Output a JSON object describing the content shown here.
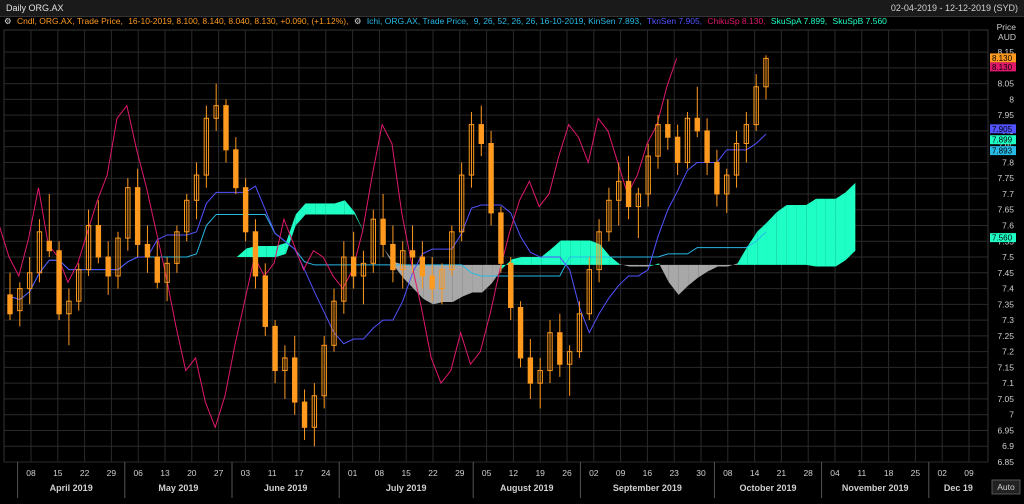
{
  "header": {
    "title": "Daily ORG.AX",
    "date_range": "02-04-2019 - 12-12-2019 (SYD)"
  },
  "legend": {
    "cndl": {
      "label": "Cndl, ORG.AX, Trade Price,",
      "vals": "16-10-2019, 8.100, 8.140, 8.040, 8.130, +0.090, (+1.12%),"
    },
    "ichi": {
      "label": "Ichi, ORG.AX, Trade Price,",
      "vals": "9, 26, 52, 26, 26, 16-10-2019, KinSen 7.893,"
    },
    "tenkan": "TknSen 7.905,",
    "chikou": "ChikuSp 8.130,",
    "spanA": "SkuSpA 7.899,",
    "spanB": "SkuSpB 7.560"
  },
  "axis": {
    "price_label": "Price",
    "currency_label": "AUD",
    "auto_label": "Auto"
  },
  "colors": {
    "bg": "#000000",
    "grid": "#2a2a2a",
    "candle": "#ff9a1e",
    "tenkan": "#5252ff",
    "kijun": "#27b9e6",
    "chikou": "#e0186c",
    "cloud_bull": "#1effc6",
    "cloud_bear": "#a8a8a8",
    "text": "#cfcfcf"
  },
  "chart_data": {
    "type": "candlestick",
    "ylim": [
      6.85,
      8.22
    ],
    "yticks": [
      6.85,
      6.9,
      6.95,
      7,
      7.05,
      7.1,
      7.15,
      7.2,
      7.25,
      7.3,
      7.35,
      7.4,
      7.45,
      7.5,
      7.55,
      7.6,
      7.65,
      7.7,
      7.75,
      7.8,
      7.85,
      7.9,
      7.95,
      8,
      8.05,
      8.1,
      8.15
    ],
    "ytick_labels": [
      "6.85",
      "6.9",
      "6.95",
      "7",
      "7.05",
      "7.1",
      "7.15",
      "7.2",
      "7.25",
      "7.3",
      "7.35",
      "7.4",
      "7.45",
      "7.5",
      "7.55",
      "7.6",
      "7.65",
      "7.7",
      "7.75",
      "7.8",
      "7.85",
      "7.9",
      "7.95",
      "8",
      "8.05",
      "8.1",
      "8.15"
    ],
    "x_dates": [
      "08",
      "15",
      "22",
      "29",
      "06",
      "13",
      "20",
      "27",
      "03",
      "11",
      "17",
      "24",
      "01",
      "08",
      "15",
      "22",
      "29",
      "05",
      "12",
      "19",
      "26",
      "02",
      "09",
      "16",
      "23",
      "30",
      "08",
      "14",
      "21",
      "28",
      "04",
      "11",
      "18",
      "25",
      "02",
      "09"
    ],
    "months": [
      "April 2019",
      "May 2019",
      "June 2019",
      "July 2019",
      "August 2019",
      "September 2019",
      "October 2019",
      "November 2019",
      "Dec 19"
    ],
    "month_start_index": [
      0,
      4,
      8,
      12,
      17,
      21,
      26,
      30,
      34
    ],
    "price_tags": [
      {
        "value": 8.13,
        "label": "8.130",
        "color": "#ff9a1e"
      },
      {
        "value": 8.13,
        "label": "8.130",
        "color": "#e0186c"
      },
      {
        "value": 7.905,
        "label": "7.905",
        "color": "#5252ff"
      },
      {
        "value": 7.899,
        "label": "7.899",
        "color": "#1effc6"
      },
      {
        "value": 7.893,
        "label": "7.893",
        "color": "#27b9e6"
      },
      {
        "value": 7.56,
        "label": "7.560",
        "color": "#1effc6"
      }
    ],
    "candles_approx": [
      [
        7.38,
        7.45,
        7.3,
        7.32
      ],
      [
        7.33,
        7.42,
        7.28,
        7.4
      ],
      [
        7.4,
        7.5,
        7.35,
        7.45
      ],
      [
        7.45,
        7.62,
        7.42,
        7.58
      ],
      [
        7.55,
        7.7,
        7.5,
        7.52
      ],
      [
        7.52,
        7.55,
        7.3,
        7.32
      ],
      [
        7.32,
        7.4,
        7.22,
        7.36
      ],
      [
        7.36,
        7.48,
        7.33,
        7.46
      ],
      [
        7.46,
        7.65,
        7.44,
        7.6
      ],
      [
        7.6,
        7.68,
        7.48,
        7.5
      ],
      [
        7.5,
        7.55,
        7.38,
        7.44
      ],
      [
        7.44,
        7.58,
        7.4,
        7.56
      ],
      [
        7.56,
        7.75,
        7.52,
        7.72
      ],
      [
        7.72,
        7.78,
        7.5,
        7.54
      ],
      [
        7.54,
        7.6,
        7.45,
        7.5
      ],
      [
        7.5,
        7.55,
        7.4,
        7.42
      ],
      [
        7.42,
        7.5,
        7.36,
        7.48
      ],
      [
        7.48,
        7.6,
        7.45,
        7.58
      ],
      [
        7.58,
        7.7,
        7.55,
        7.68
      ],
      [
        7.68,
        7.8,
        7.62,
        7.76
      ],
      [
        7.76,
        7.98,
        7.72,
        7.94
      ],
      [
        7.94,
        8.05,
        7.9,
        7.98
      ],
      [
        7.98,
        8.0,
        7.8,
        7.84
      ],
      [
        7.84,
        7.88,
        7.7,
        7.72
      ],
      [
        7.72,
        7.75,
        7.55,
        7.58
      ],
      [
        7.58,
        7.62,
        7.4,
        7.44
      ],
      [
        7.44,
        7.48,
        7.25,
        7.28
      ],
      [
        7.28,
        7.3,
        7.1,
        7.14
      ],
      [
        7.14,
        7.22,
        7.05,
        7.18
      ],
      [
        7.18,
        7.25,
        7.0,
        7.04
      ],
      [
        7.04,
        7.08,
        6.92,
        6.96
      ],
      [
        6.96,
        7.1,
        6.9,
        7.06
      ],
      [
        7.06,
        7.25,
        7.02,
        7.22
      ],
      [
        7.22,
        7.4,
        7.2,
        7.36
      ],
      [
        7.36,
        7.55,
        7.32,
        7.5
      ],
      [
        7.5,
        7.58,
        7.4,
        7.44
      ],
      [
        7.44,
        7.52,
        7.35,
        7.48
      ],
      [
        7.48,
        7.65,
        7.45,
        7.62
      ],
      [
        7.62,
        7.7,
        7.5,
        7.54
      ],
      [
        7.54,
        7.6,
        7.42,
        7.46
      ],
      [
        7.46,
        7.55,
        7.4,
        7.52
      ],
      [
        7.52,
        7.6,
        7.45,
        7.5
      ],
      [
        7.5,
        7.55,
        7.4,
        7.44
      ],
      [
        7.44,
        7.5,
        7.36,
        7.4
      ],
      [
        7.4,
        7.48,
        7.35,
        7.46
      ],
      [
        7.46,
        7.6,
        7.44,
        7.58
      ],
      [
        7.58,
        7.8,
        7.55,
        7.76
      ],
      [
        7.76,
        7.96,
        7.72,
        7.92
      ],
      [
        7.92,
        7.98,
        7.82,
        7.86
      ],
      [
        7.86,
        7.9,
        7.6,
        7.64
      ],
      [
        7.64,
        7.66,
        7.45,
        7.48
      ],
      [
        7.48,
        7.5,
        7.3,
        7.34
      ],
      [
        7.34,
        7.36,
        7.15,
        7.18
      ],
      [
        7.18,
        7.24,
        7.05,
        7.1
      ],
      [
        7.1,
        7.18,
        7.02,
        7.14
      ],
      [
        7.14,
        7.3,
        7.1,
        7.26
      ],
      [
        7.26,
        7.32,
        7.12,
        7.16
      ],
      [
        7.16,
        7.22,
        7.06,
        7.2
      ],
      [
        7.2,
        7.36,
        7.18,
        7.32
      ],
      [
        7.32,
        7.5,
        7.3,
        7.46
      ],
      [
        7.46,
        7.62,
        7.42,
        7.58
      ],
      [
        7.58,
        7.72,
        7.55,
        7.68
      ],
      [
        7.68,
        7.8,
        7.6,
        7.74
      ],
      [
        7.74,
        7.82,
        7.62,
        7.66
      ],
      [
        7.66,
        7.72,
        7.56,
        7.7
      ],
      [
        7.7,
        7.86,
        7.66,
        7.82
      ],
      [
        7.82,
        7.95,
        7.78,
        7.92
      ],
      [
        7.92,
        8.0,
        7.84,
        7.88
      ],
      [
        7.88,
        7.92,
        7.76,
        7.8
      ],
      [
        7.8,
        7.96,
        7.78,
        7.94
      ],
      [
        7.94,
        8.04,
        7.88,
        7.9
      ],
      [
        7.9,
        7.94,
        7.76,
        7.8
      ],
      [
        7.8,
        7.84,
        7.66,
        7.7
      ],
      [
        7.7,
        7.78,
        7.64,
        7.76
      ],
      [
        7.76,
        7.9,
        7.72,
        7.86
      ],
      [
        7.86,
        7.96,
        7.8,
        7.92
      ],
      [
        7.92,
        8.08,
        7.9,
        8.04
      ],
      [
        8.04,
        8.14,
        8.0,
        8.13
      ]
    ]
  }
}
